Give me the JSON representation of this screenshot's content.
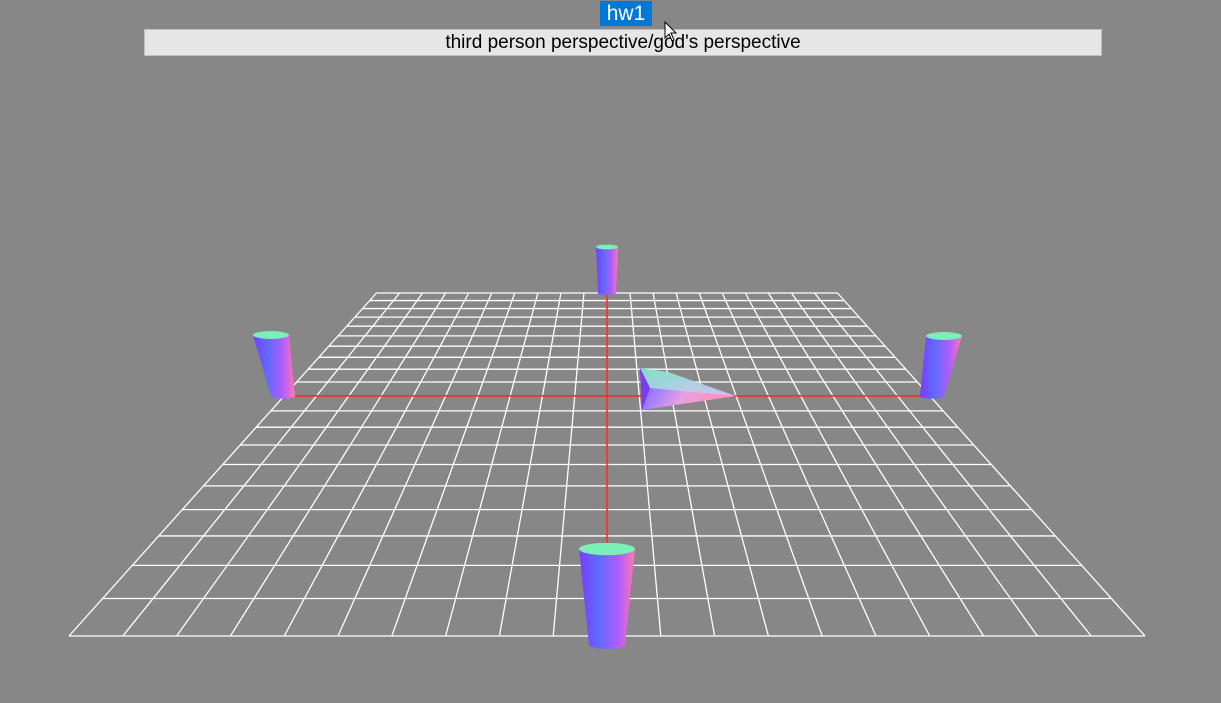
{
  "window": {
    "title": "hw1"
  },
  "view_mode": {
    "selected": "third person perspective/god's perspective"
  },
  "scene": {
    "background_color": "#878787",
    "grid": {
      "color": "#ffffff",
      "divisions": 20
    },
    "axes": {
      "color": "#ff2020"
    },
    "objects": [
      "cylinder-back",
      "cylinder-left",
      "cylinder-right",
      "cylinder-front",
      "cone-player"
    ]
  },
  "colors": {
    "selection": "#0078d7",
    "cap": "#7af0b8",
    "body_left": "#6a5cff",
    "body_right": "#ff6fb0"
  }
}
